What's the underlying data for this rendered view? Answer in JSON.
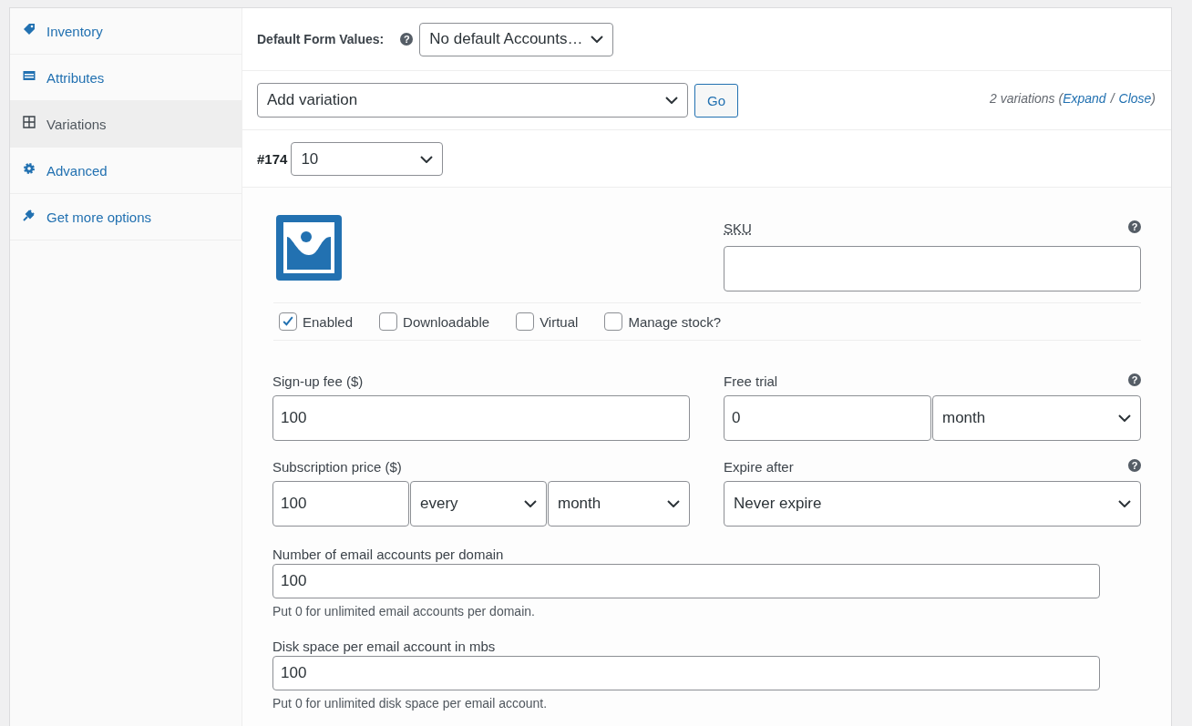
{
  "sidebar": {
    "items": [
      {
        "label": "Inventory",
        "selected": false
      },
      {
        "label": "Attributes",
        "selected": false
      },
      {
        "label": "Variations",
        "selected": true
      },
      {
        "label": "Advanced",
        "selected": false
      },
      {
        "label": "Get more options",
        "selected": false
      }
    ]
  },
  "default_form_values": {
    "label": "Default Form Values:",
    "help": "?",
    "value": "No default Accounts…"
  },
  "add_variation": {
    "value": "Add variation",
    "button": "Go"
  },
  "variations_summary": {
    "prefix": "2 variations (",
    "links": [
      "Expand",
      "Close"
    ],
    "separator": "/",
    "suffix": ")"
  },
  "variation": {
    "id": "#174",
    "value": "10",
    "sku": {
      "label": "SKU",
      "help": "?"
    },
    "checkboxes": [
      {
        "label": "Enabled",
        "checked": true
      },
      {
        "label": "Downloadable",
        "checked": false
      },
      {
        "label": "Virtual",
        "checked": false
      },
      {
        "label": "Manage stock?",
        "checked": false
      }
    ],
    "signup_fee": {
      "label": "Sign-up fee ($)",
      "value": "100"
    },
    "free_trial": {
      "label": "Free trial",
      "help": "?",
      "value": "0",
      "period": "month"
    },
    "subscription_price": {
      "label": "Subscription price ($)",
      "value": "100",
      "interval": "every",
      "period": "month"
    },
    "expire_after": {
      "label": "Expire after",
      "help": "?",
      "value": "Never expire"
    },
    "extra_fields": [
      {
        "label": "Number of email accounts per domain",
        "value": "100",
        "hint": "Put 0 for unlimited email accounts per domain."
      },
      {
        "label": "Disk space per email account in mbs",
        "value": "100",
        "hint": "Put 0 for unlimited disk space per email account."
      }
    ]
  }
}
